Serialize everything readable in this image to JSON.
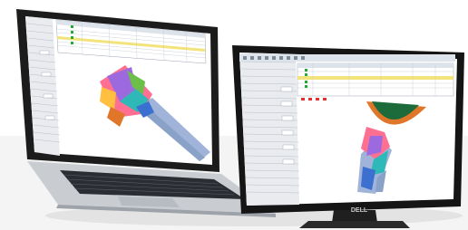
{
  "scene": {
    "left_device": "laptop",
    "right_device": "monitor",
    "monitor_brand": "DELL",
    "left_screen_content": "cad-software-3d-cutting-tool",
    "right_screen_content": "cad-software-3d-cutting-tool"
  },
  "colors": {
    "background": "#ffffff",
    "laptop_body": "#c9cdd2",
    "laptop_bezel": "#1c1c1c",
    "monitor_bezel": "#151515",
    "screen_bg": "#ffffff",
    "panel_bg": "#e9ebef",
    "grid_yellow": "#f2e37a",
    "tool_blue": "#9fb4d8",
    "flute_green": "#1d6a3a",
    "flute_orange": "#e0762a",
    "multi_color": [
      "#ff6f91",
      "#9c6ade",
      "#2eb8b8",
      "#ffbf40",
      "#6cc04a"
    ]
  }
}
